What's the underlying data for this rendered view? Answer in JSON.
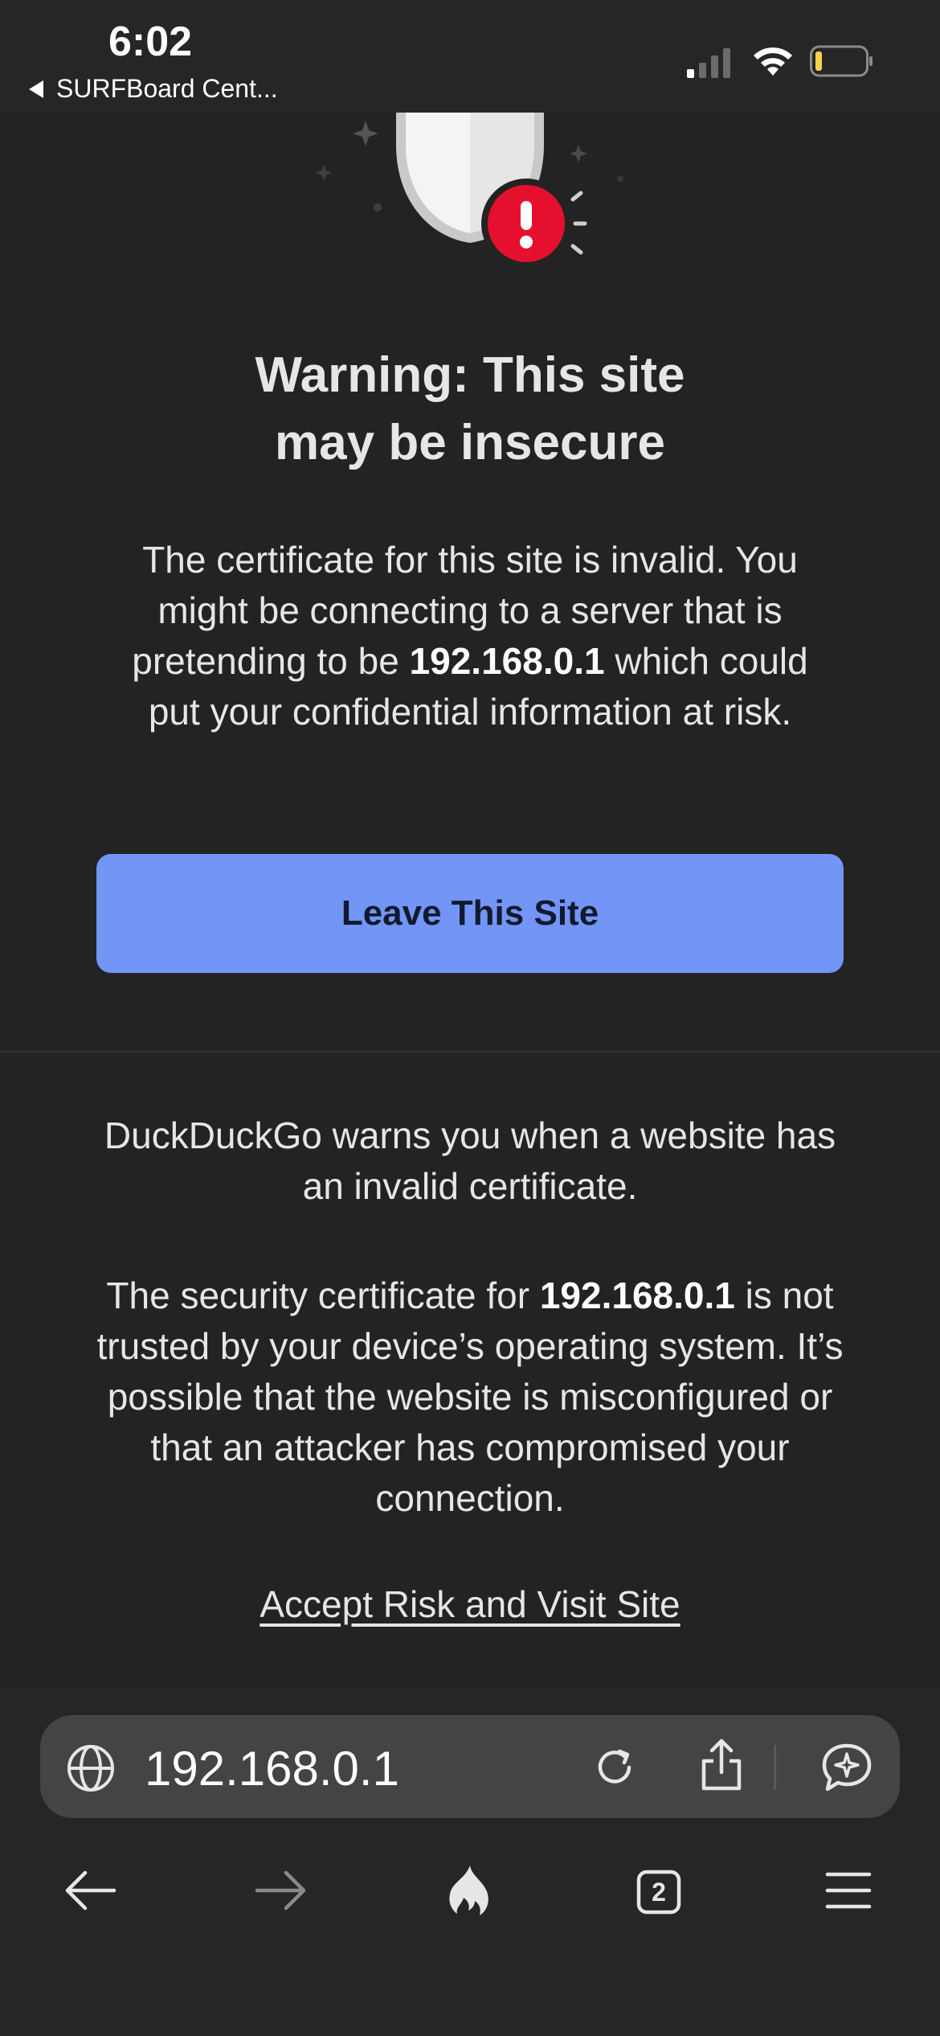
{
  "status_bar": {
    "time": "6:02",
    "back_app": "SURFBoard Cent...",
    "battery_color": "#f7d24a"
  },
  "warning": {
    "title_line1": "Warning: This site",
    "title_line2": "may be insecure",
    "desc_part1": "The certificate for this site is invalid. You might be connecting to a server that is pretending to be ",
    "desc_host": "192.168.0.1",
    "desc_part2": " which could put your confidential information at risk."
  },
  "leave_button": {
    "label": "Leave This Site",
    "color": "#7295f6"
  },
  "details": {
    "info1": "DuckDuckGo warns you when a website has an invalid certificate.",
    "info2_part1": "The security certificate for ",
    "info2_host": "192.168.0.1",
    "info2_part2": " is not trusted by your device’s operating system. It’s possible that the website is misconfigured or that an attacker has compromised your connection.",
    "accept_link": "Accept Risk and Visit Site"
  },
  "address_bar": {
    "url": "192.168.0.1",
    "icons": [
      "globe-icon",
      "reload-icon",
      "share-icon",
      "ai-chat-icon"
    ]
  },
  "toolbar": {
    "tab_count": "2",
    "icons": [
      "back-arrow-icon",
      "forward-arrow-icon",
      "fire-icon",
      "tabs-icon",
      "menu-icon"
    ]
  },
  "colors": {
    "background": "#232323",
    "alert_red": "#e5102d"
  }
}
